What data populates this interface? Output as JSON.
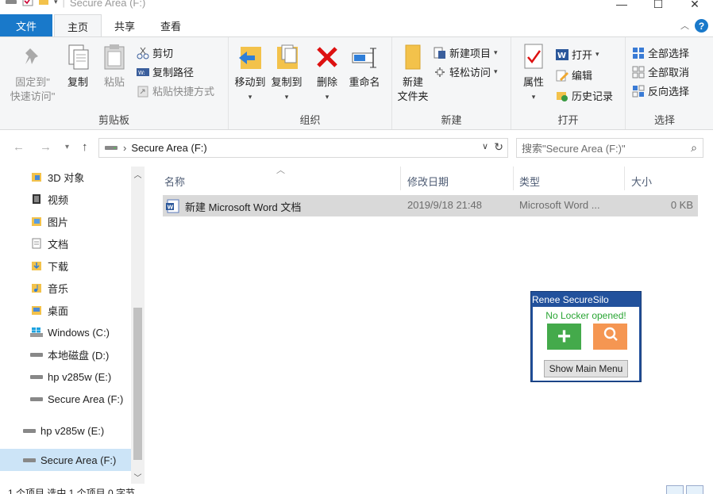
{
  "window": {
    "title": "Secure Area (F:)"
  },
  "tabs": {
    "file": "文件",
    "items": [
      "主页",
      "共享",
      "查看"
    ]
  },
  "ribbon": {
    "clipboard": {
      "label": "剪贴板",
      "pin": "固定到\"\n快速访问\"",
      "copy": "复制",
      "paste": "粘贴",
      "cut": "剪切",
      "copy_path": "复制路径",
      "paste_shortcut": "粘贴快捷方式"
    },
    "organize": {
      "label": "组织",
      "move_to": "移动到",
      "copy_to": "复制到",
      "delete": "删除",
      "rename": "重命名"
    },
    "new": {
      "label": "新建",
      "new_folder": "新建\n文件夹",
      "new_item": "新建项目",
      "easy_access": "轻松访问"
    },
    "open": {
      "label": "打开",
      "properties": "属性",
      "open": "打开",
      "edit": "编辑",
      "history": "历史记录"
    },
    "select": {
      "label": "选择",
      "select_all": "全部选择",
      "select_none": "全部取消",
      "invert": "反向选择"
    }
  },
  "address": {
    "path": "Secure Area (F:)",
    "search_placeholder": "搜索\"Secure Area (F:)\""
  },
  "nav": {
    "items": [
      {
        "label": "3D 对象",
        "icon": "3d-objects-icon"
      },
      {
        "label": "视频",
        "icon": "videos-icon"
      },
      {
        "label": "图片",
        "icon": "pictures-icon"
      },
      {
        "label": "文档",
        "icon": "documents-icon"
      },
      {
        "label": "下载",
        "icon": "downloads-icon"
      },
      {
        "label": "音乐",
        "icon": "music-icon"
      },
      {
        "label": "桌面",
        "icon": "desktop-icon"
      },
      {
        "label": "Windows (C:)",
        "icon": "windows-drive-icon"
      },
      {
        "label": "本地磁盘 (D:)",
        "icon": "drive-icon"
      },
      {
        "label": "hp v285w (E:)",
        "icon": "drive-icon"
      },
      {
        "label": "Secure Area (F:)",
        "icon": "drive-icon"
      },
      {
        "label": "hp v285w (E:)",
        "icon": "drive-icon"
      },
      {
        "label": "Secure Area (F:)",
        "icon": "drive-icon"
      }
    ]
  },
  "list": {
    "columns": [
      "名称",
      "修改日期",
      "类型",
      "大小"
    ],
    "rows": [
      {
        "name": "新建 Microsoft Word 文档",
        "date": "2019/9/18 21:48",
        "type": "Microsoft Word ...",
        "size": "0 KB"
      }
    ]
  },
  "silo": {
    "title": "Renee SecureSilo",
    "status": "No Locker opened!",
    "add_label": "+",
    "main_menu": "Show Main Menu"
  },
  "statusbar": {
    "text": "1 个项目    选中 1 个项目  0 字节"
  },
  "colors": {
    "accent": "#1979ca",
    "selection": "#cce4f7",
    "silo_blue": "#22519c",
    "silo_green": "#44aa4b",
    "silo_orange": "#f59652"
  }
}
